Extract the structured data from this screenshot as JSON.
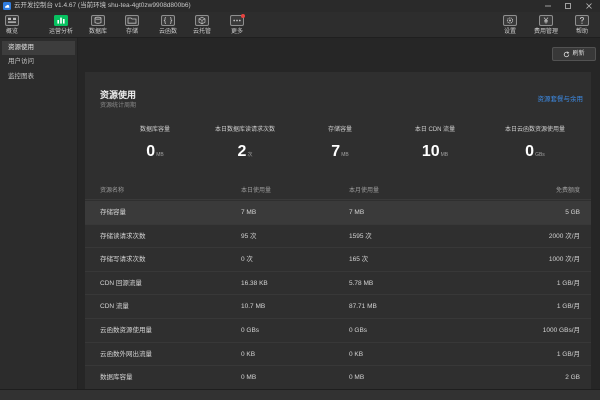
{
  "window": {
    "title": "云开发控制台 v1.4.67 (当前环境 shu-tea-4gt0zw9908d800b6)",
    "app_icon": "cloud-console-icon",
    "controls": [
      "minimize-icon",
      "maximize-icon",
      "close-icon"
    ]
  },
  "toolbar": {
    "left": [
      {
        "label": "概览",
        "icon": "overview-icon"
      },
      {
        "label": "运营分析",
        "icon": "analytics-icon",
        "active": true
      },
      {
        "label": "数据库",
        "icon": "database-icon"
      },
      {
        "label": "存储",
        "icon": "storage-icon"
      },
      {
        "label": "云函数",
        "icon": "cloud-function-icon"
      },
      {
        "label": "云托管",
        "icon": "cloud-hosting-icon"
      },
      {
        "label": "更多",
        "icon": "more-icon",
        "badge": true
      }
    ],
    "right": [
      {
        "label": "设置",
        "icon": "settings-icon"
      },
      {
        "label": "费用管理",
        "icon": "billing-icon"
      },
      {
        "label": "帮助",
        "icon": "help-icon"
      }
    ]
  },
  "sidebar": {
    "items": [
      {
        "label": "资源使用",
        "selected": true
      },
      {
        "label": "用户访问"
      },
      {
        "label": "监控图表"
      }
    ]
  },
  "main": {
    "refresh": {
      "label": "刷新",
      "icon": "refresh-icon"
    },
    "panel": {
      "title": "资源使用",
      "subtitle": "资源统计周期",
      "link": "资源套餐与余用",
      "stats": [
        {
          "label": "数据库容量",
          "value": "0",
          "unit": "MB"
        },
        {
          "label": "本日数据库读请求次数",
          "value": "2",
          "unit": "次"
        },
        {
          "label": "存储容量",
          "value": "7",
          "unit": "MB"
        },
        {
          "label": "本日 CDN 流量",
          "value": "10",
          "unit": "MB"
        },
        {
          "label": "本日云函数资源使用量",
          "value": "0",
          "unit": "GBs"
        }
      ],
      "table": {
        "headers": [
          "资源名称",
          "本日使用量",
          "本月使用量",
          "免费额度"
        ],
        "rows": [
          [
            "存储容量",
            "7 MB",
            "7 MB",
            "5 GB"
          ],
          [
            "存储读请求次数",
            "95 次",
            "1595 次",
            "2000 次/月"
          ],
          [
            "存储写请求次数",
            "0 次",
            "165 次",
            "1000 次/月"
          ],
          [
            "CDN 回源流量",
            "16.38 KB",
            "5.78 MB",
            "1 GB/月"
          ],
          [
            "CDN 流量",
            "10.7 MB",
            "87.71 MB",
            "1 GB/月"
          ],
          [
            "云函数资源使用量",
            "0 GBs",
            "0 GBs",
            "1000 GBs/月"
          ],
          [
            "云函数外网出流量",
            "0 KB",
            "0 KB",
            "1 GB/月"
          ],
          [
            "数据库容量",
            "0 MB",
            "0 MB",
            "2 GB"
          ]
        ]
      }
    }
  },
  "colors": {
    "accent": "#07c160",
    "link": "#3d8be5",
    "badge": "#e64340",
    "background": "#262626",
    "panel": "#2f2f2f",
    "row_highlight": "#3a3a3a"
  }
}
